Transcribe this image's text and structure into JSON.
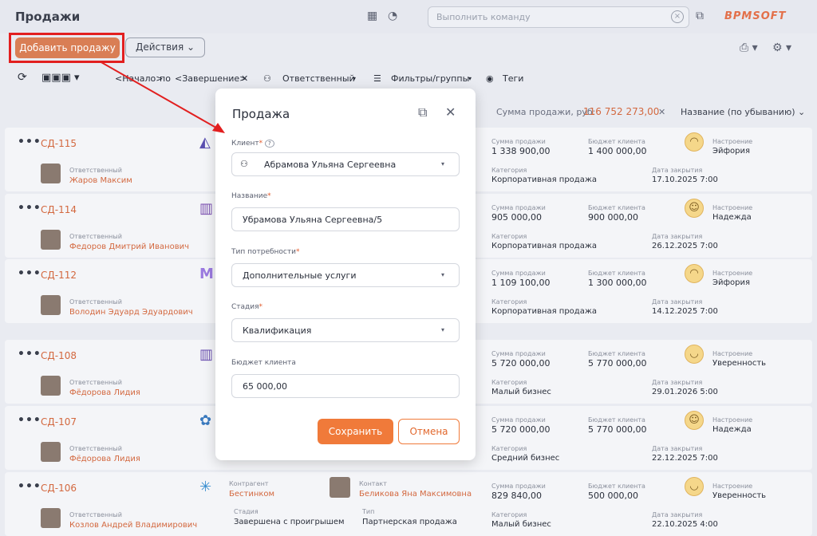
{
  "header": {
    "title": "Продажи",
    "command_placeholder": "Выполнить команду",
    "logo": "BPMSOFT"
  },
  "toolbar": {
    "add_label": "Добавить продажу",
    "actions_label": "Действия"
  },
  "filters": {
    "range_start": "<Начало>",
    "range_by": "по",
    "range_end": "<Завершение>",
    "responsible": "Ответственный",
    "filters_groups": "Фильтры/группы",
    "tags": "Теги"
  },
  "summary": {
    "label": "Сумма продажи, руб:",
    "value": "116 752 273,00",
    "sort": "Название (по убыванию)"
  },
  "labels": {
    "responsible": "Ответственный",
    "sale_sum": "Сумма продажи",
    "client_budget": "Бюджет клиента",
    "category": "Категория",
    "close_date": "Дата закрытия",
    "mood": "Настроение",
    "account": "Контрагент",
    "contact": "Контакт",
    "stage": "Стадия",
    "type": "Тип"
  },
  "rows": [
    {
      "id": "СД-115",
      "responsible": "Жаров Максим",
      "sum": "1 338 900,00",
      "budget": "1 400 000,00",
      "category": "Корпоративная продажа",
      "date": "17.10.2025 7:00",
      "mood": "Эйфория"
    },
    {
      "id": "СД-114",
      "responsible": "Федоров Дмитрий Иванович",
      "sum": "905 000,00",
      "budget": "900 000,00",
      "category": "Корпоративная продажа",
      "date": "26.12.2025 7:00",
      "mood": "Надежда"
    },
    {
      "id": "СД-112",
      "responsible": "Володин Эдуард Эдуардович",
      "sum": "1 109 100,00",
      "budget": "1 300 000,00",
      "category": "Корпоративная продажа",
      "date": "14.12.2025 7:00",
      "mood": "Эйфория"
    },
    {
      "id": "СД-108",
      "responsible": "Фёдорова Лидия",
      "sum": "5 720 000,00",
      "budget": "5 770 000,00",
      "category": "Малый бизнес",
      "date": "29.01.2026 5:00",
      "mood": "Уверенность"
    },
    {
      "id": "СД-107",
      "responsible": "Фёдорова Лидия",
      "sum": "5 720 000,00",
      "budget": "5 770 000,00",
      "category": "Средний бизнес",
      "date": "22.12.2025 7:00",
      "mood": "Надежда"
    },
    {
      "id": "СД-106",
      "responsible": "Козлов Андрей Владимирович",
      "sum": "829 840,00",
      "budget": "500 000,00",
      "category": "Малый бизнес",
      "date": "22.10.2025 4:00",
      "mood": "Уверенность",
      "account": "Бестинком",
      "contact": "Беликова Яна Максимовна",
      "stage": "Завершена с проигрышем",
      "type": "Партнерская продажа"
    }
  ],
  "modal": {
    "title": "Продажа",
    "client_label": "Клиент",
    "client_value": "Абрамова Ульяна Сергеевна",
    "name_label": "Название",
    "name_value": "Убрамова Ульяна Сергеевна/5",
    "need_label": "Тип потребности",
    "need_value": "Дополнительные услуги",
    "stage_label": "Стадия",
    "stage_value": "Квалификация",
    "budget_label": "Бюджет клиента",
    "budget_value": "65 000,00",
    "save": "Сохранить",
    "cancel": "Отмена"
  },
  "colors": {
    "accent": "#f07a3a",
    "link": "#d3683f",
    "highlight": "#e21f1f"
  }
}
